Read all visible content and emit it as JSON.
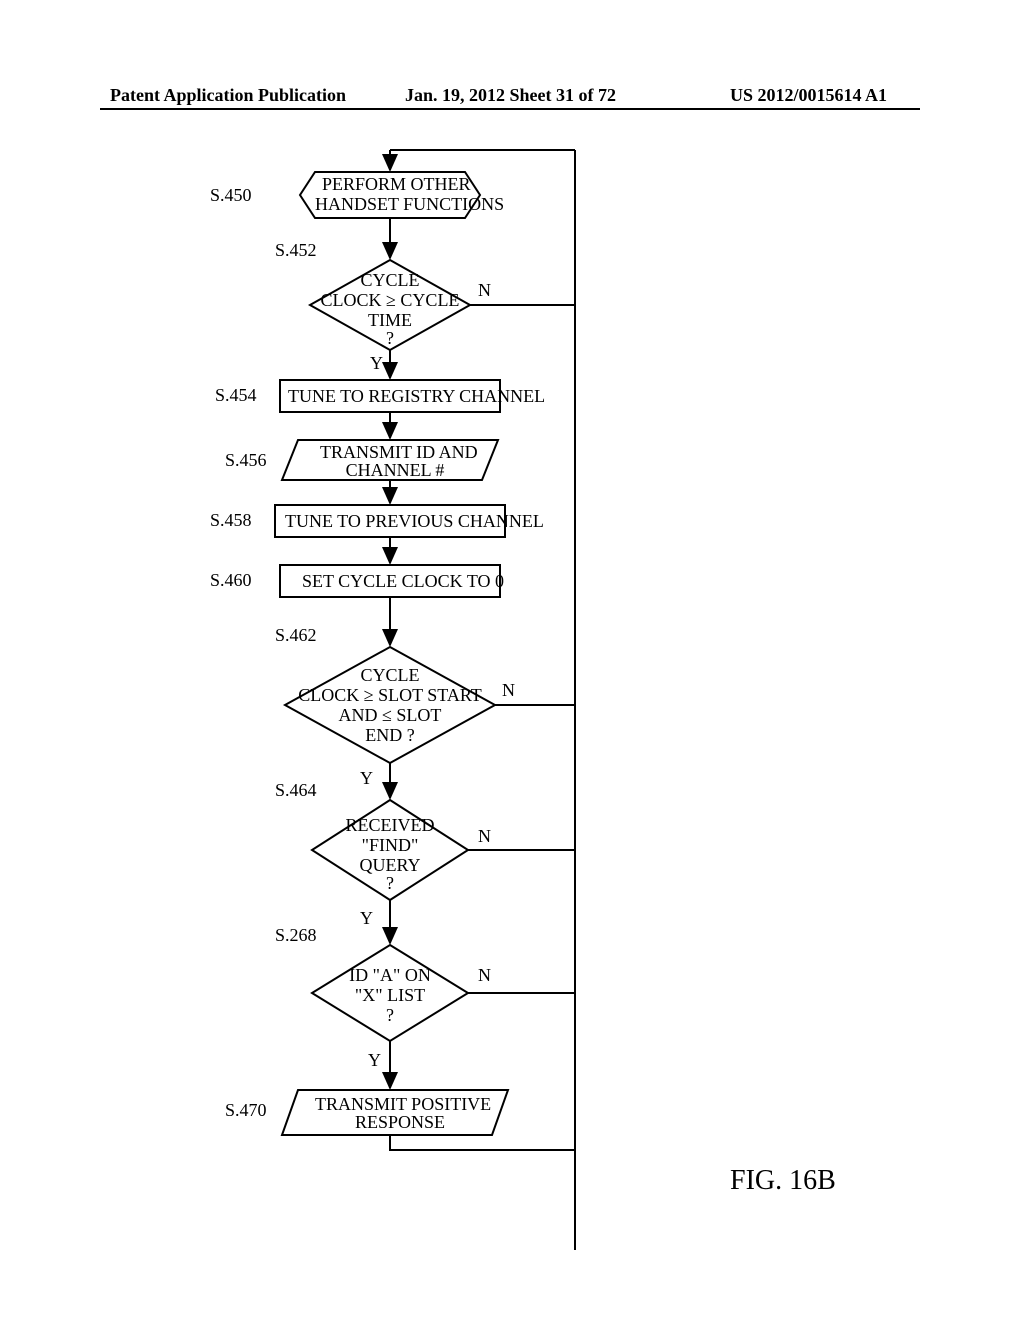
{
  "header": {
    "left": "Patent Application Publication",
    "center": "Jan. 19, 2012   Sheet 31 of 72",
    "right": "US 2012/0015614 A1"
  },
  "steps": {
    "s450": {
      "ref": "S.450",
      "text1": "PERFORM OTHER",
      "text2": "HANDSET FUNCTIONS"
    },
    "s452": {
      "ref": "S.452",
      "text1": "CYCLE",
      "text2": "CLOCK ≥ CYCLE",
      "text3": "TIME",
      "text4": "?"
    },
    "s454": {
      "ref": "S.454",
      "text": "TUNE TO REGISTRY CHANNEL"
    },
    "s456": {
      "ref": "S.456",
      "text1": "TRANSMIT ID AND",
      "text2": "CHANNEL #"
    },
    "s458": {
      "ref": "S.458",
      "text": "TUNE TO PREVIOUS CHANNEL"
    },
    "s460": {
      "ref": "S.460",
      "text": "SET CYCLE CLOCK TO 0"
    },
    "s462": {
      "ref": "S.462",
      "text1": "CYCLE",
      "text2": "CLOCK ≥ SLOT START",
      "text3": "AND ≤ SLOT",
      "text4": "END ?"
    },
    "s464": {
      "ref": "S.464",
      "text1": "RECEIVED",
      "text2": "\"FIND\"",
      "text3": "QUERY",
      "text4": "?"
    },
    "s268": {
      "ref": "S.268",
      "text1": "ID \"A\" ON",
      "text2": "\"X\" LIST",
      "text3": "?"
    },
    "s470": {
      "ref": "S.470",
      "text1": "TRANSMIT POSITIVE",
      "text2": "RESPONSE"
    }
  },
  "labels": {
    "yes": "Y",
    "no": "N"
  },
  "figure": "FIG. 16B"
}
